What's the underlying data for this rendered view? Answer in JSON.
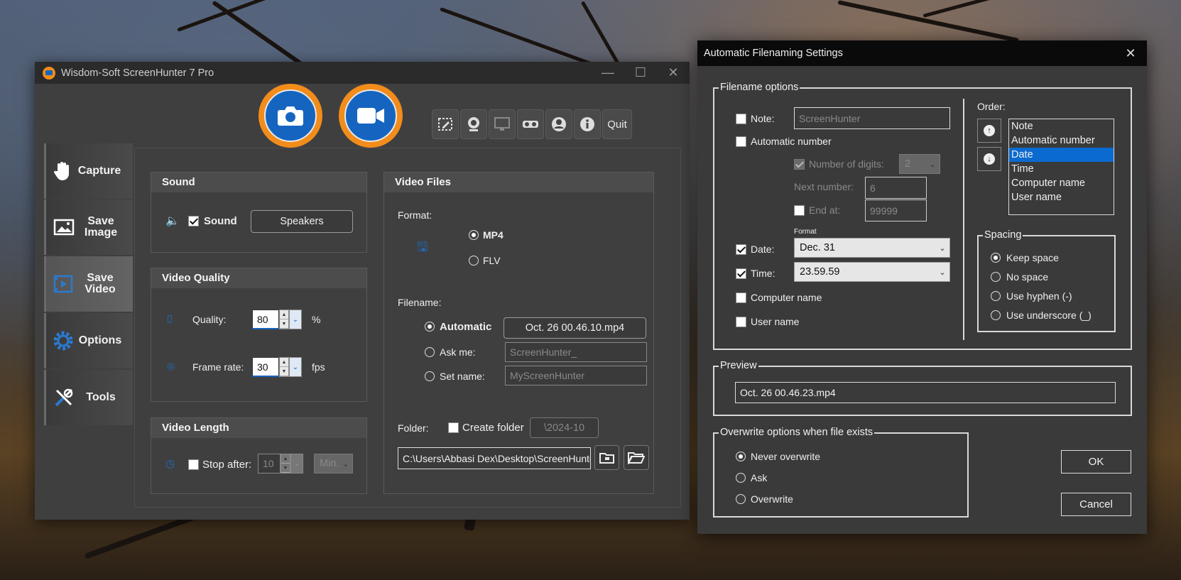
{
  "main_window": {
    "title": "Wisdom-Soft ScreenHunter 7 Pro",
    "controls": {
      "minimize": "—",
      "maximize": "☐",
      "close": "✕"
    },
    "toolbar": {
      "quit": "Quit"
    },
    "sidebar": [
      {
        "label": "Capture",
        "icon": "hand-icon"
      },
      {
        "label": "Save Image",
        "icon": "image-icon"
      },
      {
        "label": "Save Video",
        "icon": "video-file-icon",
        "active": true
      },
      {
        "label": "Options",
        "icon": "gear-icon"
      },
      {
        "label": "Tools",
        "icon": "tools-icon"
      }
    ],
    "sound": {
      "header": "Sound",
      "checkbox_label": "Sound",
      "checked": true,
      "device_button": "Speakers"
    },
    "video_quality": {
      "header": "Video Quality",
      "quality_label": "Quality:",
      "quality_value": "80",
      "quality_unit": "%",
      "framerate_label": "Frame rate:",
      "framerate_value": "30",
      "framerate_unit": "fps"
    },
    "video_length": {
      "header": "Video Length",
      "stop_after_label": "Stop after:",
      "stop_after_value": "10",
      "unit": "Min."
    },
    "video_files": {
      "header": "Video Files",
      "format_label": "Format:",
      "formats": [
        "MP4",
        "FLV"
      ],
      "selected_format": "MP4",
      "filename_label": "Filename:",
      "automatic_label": "Automatic",
      "automatic_value": "Oct. 26 00.46.10.mp4",
      "ask_me_label": "Ask me:",
      "ask_me_value": "ScreenHunter_",
      "set_name_label": "Set name:",
      "set_name_value": "MyScreenHunter",
      "folder_label": "Folder:",
      "create_folder_label": "Create folder",
      "create_folder_value": "\\2024-10",
      "folder_path": "C:\\Users\\Abbasi Dex\\Desktop\\ScreenHunter"
    }
  },
  "dialog": {
    "title": "Automatic Filenaming Settings",
    "close": "✕",
    "filename_options": {
      "legend": "Filename options",
      "note_label": "Note:",
      "note_value": "ScreenHunter",
      "auto_number_label": "Automatic number",
      "num_digits_label": "Number of digits:",
      "num_digits_value": "2",
      "next_number_label": "Next number:",
      "next_number_value": "6",
      "end_at_label": "End at:",
      "end_at_value": "99999",
      "format_caption": "Format",
      "date_label": "Date:",
      "date_value": "Dec. 31",
      "time_label": "Time:",
      "time_value": "23.59.59",
      "computer_name_label": "Computer name",
      "user_name_label": "User name"
    },
    "order": {
      "label": "Order:",
      "items": [
        "Note",
        "Automatic number",
        "Date",
        "Time",
        "Computer name",
        "User name"
      ],
      "selected": "Date"
    },
    "spacing": {
      "legend": "Spacing",
      "options": [
        "Keep space",
        "No space",
        "Use hyphen (-)",
        "Use underscore (_)"
      ],
      "selected": "Keep space"
    },
    "preview": {
      "legend": "Preview",
      "value": "Oct. 26 00.46.23.mp4"
    },
    "overwrite": {
      "legend": "Overwrite options when file exists",
      "options": [
        "Never overwrite",
        "Ask",
        "Overwrite"
      ],
      "selected": "Never overwrite"
    },
    "ok": "OK",
    "cancel": "Cancel"
  },
  "colors": {
    "accent_orange": "#f28c1a",
    "accent_blue": "#1565c0",
    "selection_blue": "#0a6ad0"
  }
}
